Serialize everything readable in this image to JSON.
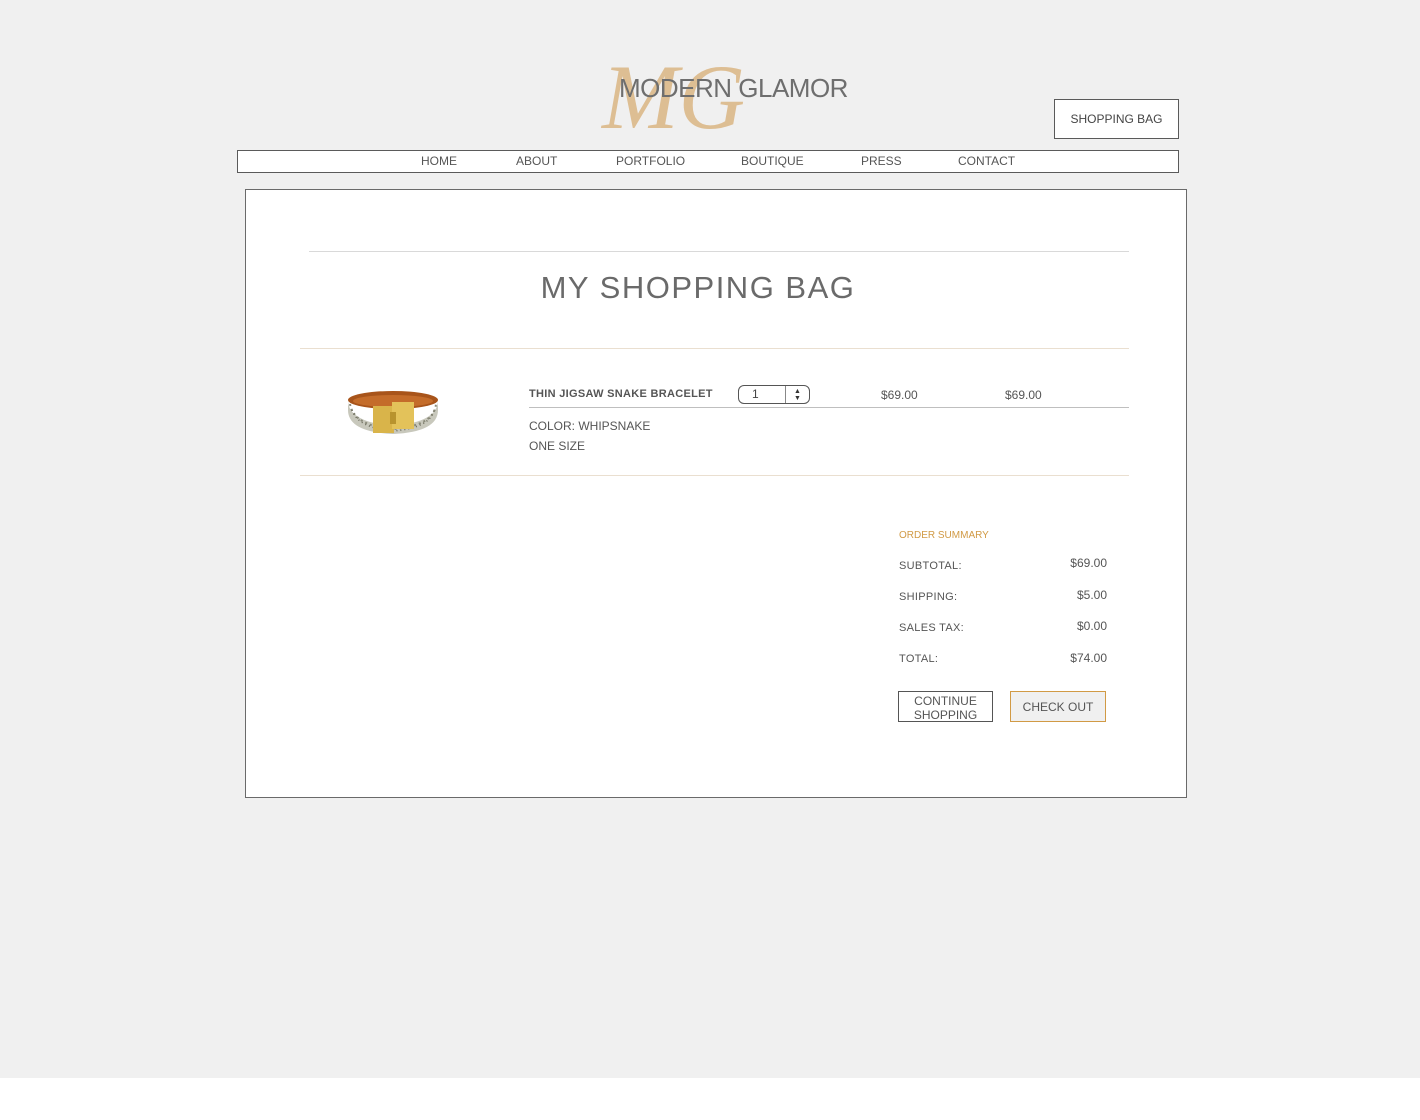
{
  "brand": {
    "monogram": "MG",
    "name": "MODERN GLAMOR",
    "monogram_color": "#dcb98a"
  },
  "header": {
    "shopping_bag_label": "SHOPPING BAG"
  },
  "nav": {
    "items": [
      {
        "label": "HOME"
      },
      {
        "label": "ABOUT"
      },
      {
        "label": "PORTFOLIO"
      },
      {
        "label": "BOUTIQUE"
      },
      {
        "label": "PRESS"
      },
      {
        "label": "CONTACT"
      }
    ]
  },
  "bag": {
    "title": "MY SHOPPING BAG",
    "items": [
      {
        "name": "THIN JIGSAW SNAKE BRACELET",
        "quantity": "1",
        "unit_price": "$69.00",
        "total_price": "$69.00",
        "color": "COLOR: WHIPSNAKE",
        "size": "ONE SIZE",
        "image_icon": "bracelet-image"
      }
    ]
  },
  "summary": {
    "heading": "ORDER SUMMARY",
    "heading_color": "#d19a45",
    "rows": [
      {
        "label": "SUBTOTAL:",
        "value": "$69.00"
      },
      {
        "label": "SHIPPING:",
        "value": "$5.00"
      },
      {
        "label": "SALES TAX:",
        "value": "$0.00"
      },
      {
        "label": "TOTAL:",
        "value": "$74.00"
      }
    ],
    "continue_label_line1": "CONTINUE",
    "continue_label_line2": "SHOPPING",
    "checkout_label": "CHECK OUT",
    "checkout_border_color": "#d19a45"
  }
}
